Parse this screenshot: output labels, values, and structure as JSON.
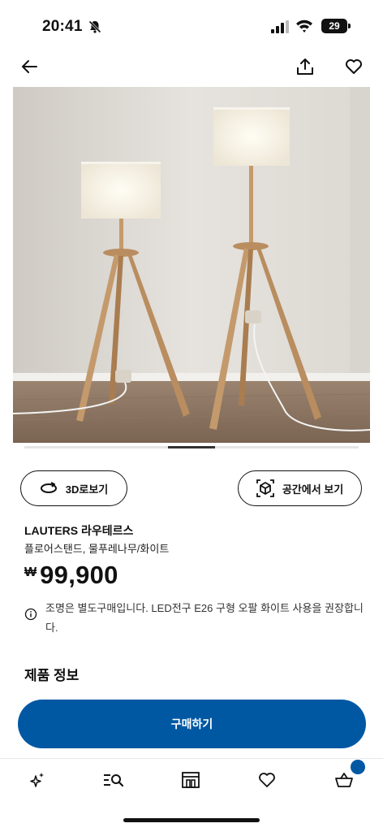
{
  "status_bar": {
    "time": "20:41",
    "battery": "29",
    "icons": [
      "bell-slash-icon",
      "signal-icon",
      "wifi-icon",
      "battery-icon"
    ]
  },
  "nav": {
    "icons": [
      "back-arrow-icon",
      "share-icon",
      "heart-icon"
    ]
  },
  "gallery": {
    "image_subject": "two wooden tripod floor lamps with white shades",
    "current_index": 1
  },
  "actions": {
    "view_3d_label": "3D로보기",
    "view_in_room_label": "공간에서 보기"
  },
  "product": {
    "name": "LAUTERS 라우테르스",
    "description": "플로어스탠드, 물푸레나무/화이트",
    "currency": "₩",
    "price": "99,900",
    "note": "조명은 별도구매입니다. LED전구 E26 구형 오팔 화이트 사용을 권장합니다."
  },
  "section": {
    "title": "제품 정보"
  },
  "cta": {
    "buy_label": "구매하기"
  },
  "tabbar": {
    "items": [
      "sparkle-icon",
      "search-list-icon",
      "store-icon",
      "heart-icon",
      "basket-icon"
    ],
    "cart_has_items": true
  },
  "colors": {
    "primary": "#0058a3",
    "text": "#111111"
  }
}
